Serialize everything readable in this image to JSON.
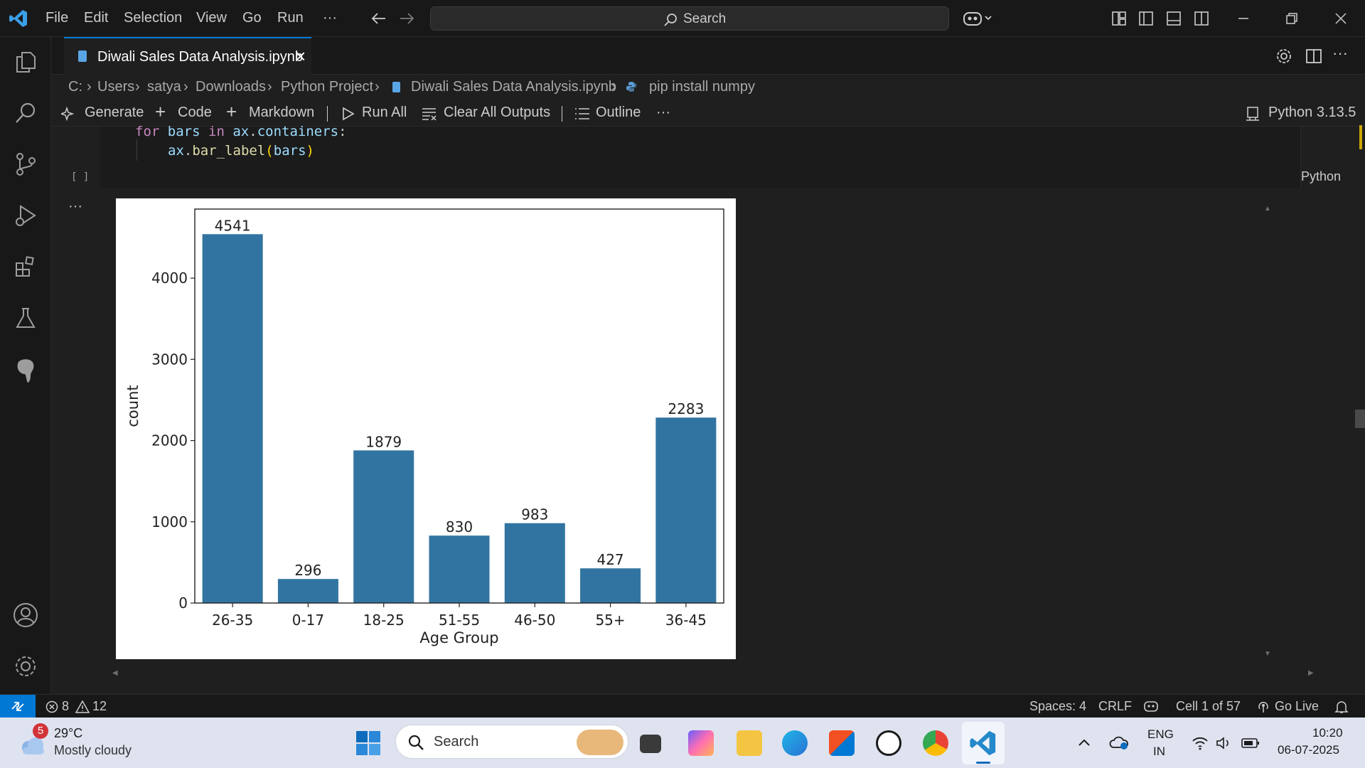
{
  "menu": [
    "File",
    "Edit",
    "Selection",
    "View",
    "Go",
    "Run",
    "···"
  ],
  "search": {
    "label": "Search"
  },
  "tab": {
    "name": "Diwali Sales Data Analysis.ipynb",
    "close": "×"
  },
  "breadcrumb": [
    "C:",
    "Users",
    "satya",
    "Downloads",
    "Python Project",
    "Diwali Sales Data Analysis.ipynb",
    "pip install numpy"
  ],
  "toolbar": {
    "generate": "Generate",
    "code": "Code",
    "markdown": "Markdown",
    "run_all": "Run All",
    "clear_outputs": "Clear All Outputs",
    "outline": "Outline",
    "more": "···",
    "kernel": "Python 3.13.5"
  },
  "cell": {
    "line1": {
      "kw": "for",
      "var1": "bars",
      "kw2": "in",
      "var2": "ax",
      "dot": ".",
      "attr": "containers",
      "colon": ":"
    },
    "line2": {
      "obj": "ax",
      "dot": ".",
      "fn": "bar_label",
      "open": "(",
      "arg": "bars",
      "close": ")"
    },
    "exec_count": "[ ]",
    "language": "Python",
    "output_menu": "···"
  },
  "chart_data": {
    "type": "bar",
    "categories": [
      "26-35",
      "0-17",
      "18-25",
      "51-55",
      "46-50",
      "55+",
      "36-45"
    ],
    "values": [
      4541,
      296,
      1879,
      830,
      983,
      427,
      2283
    ],
    "xlabel": "Age Group",
    "ylabel": "count",
    "ylim": [
      0,
      4850
    ],
    "yticks": [
      0,
      1000,
      2000,
      3000,
      4000
    ],
    "bar_color": "#3274a1",
    "grid": false,
    "data_labels": true
  },
  "status": {
    "errors": "8",
    "warnings": "12",
    "spaces": "Spaces: 4",
    "eol": "CRLF",
    "cell": "Cell 1 of 57",
    "go_live": "Go Live"
  },
  "taskbar": {
    "weather_badge": "5",
    "temperature": "29°C",
    "condition": "Mostly cloudy",
    "search": "Search",
    "lang1": "ENG",
    "lang2": "IN",
    "time": "10:20",
    "date": "06-07-2025"
  },
  "colors": {
    "accent": "#0078d4",
    "bar": "#3274a1"
  }
}
